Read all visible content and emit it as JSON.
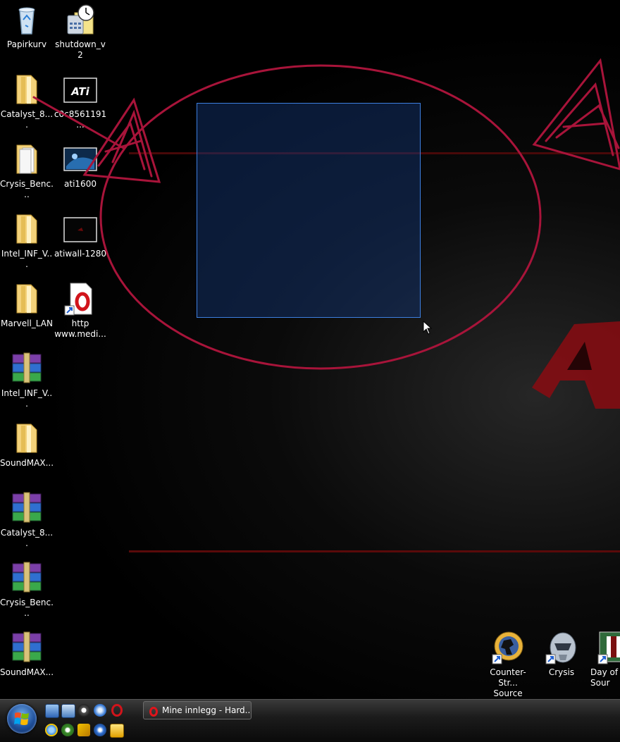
{
  "desktop_icons": [
    {
      "name": "Papirkurv",
      "icon": "recycle-bin-icon"
    },
    {
      "name": "shutdown_v2",
      "icon": "clock-shortcut-icon"
    },
    {
      "name": "Catalyst_8....",
      "icon": "folder-icon"
    },
    {
      "name": "c0c8561191...",
      "icon": "ati-image-icon"
    },
    {
      "name": "Crysis_Benc...",
      "icon": "folder-icon"
    },
    {
      "name": "ati1600",
      "icon": "image-thumbnail-icon"
    },
    {
      "name": "Intel_INF_V...",
      "icon": "folder-icon"
    },
    {
      "name": "atiwall-1280",
      "icon": "image-thumbnail-icon"
    },
    {
      "name": "Marvell_LAN",
      "icon": "folder-icon"
    },
    {
      "name": "http\nwww.medi...",
      "icon": "opera-shortcut-icon"
    },
    {
      "name": "Intel_INF_V...",
      "icon": "winrar-archive-icon"
    },
    {
      "name": "SoundMAX...",
      "icon": "folder-icon"
    },
    {
      "name": "Catalyst_8....",
      "icon": "winrar-archive-icon"
    },
    {
      "name": "Crysis_Benc...",
      "icon": "winrar-archive-icon"
    },
    {
      "name": "SoundMAX...",
      "icon": "winrar-archive-icon"
    },
    {
      "name": "Counter-Str...\nSource",
      "icon": "counter-strike-icon"
    },
    {
      "name": "Crysis",
      "icon": "crysis-icon"
    },
    {
      "name": "Day of D\nSour",
      "icon": "day-of-defeat-icon"
    }
  ],
  "taskbar": {
    "window_button_label": "Mine innlegg - Hard...",
    "quick_launch": [
      "show-desktop-icon",
      "switch-windows-icon",
      "steam-icon",
      "network-icon",
      "opera-icon",
      "internet-explorer-icon",
      "utorrent-icon",
      "winamp-icon",
      "ati-icon",
      "media-player-icon"
    ]
  },
  "colors": {
    "annotation_red": "#a8143a",
    "selection_border": "#3d7fe0",
    "wallpaper_red": "#5a0a0a"
  }
}
